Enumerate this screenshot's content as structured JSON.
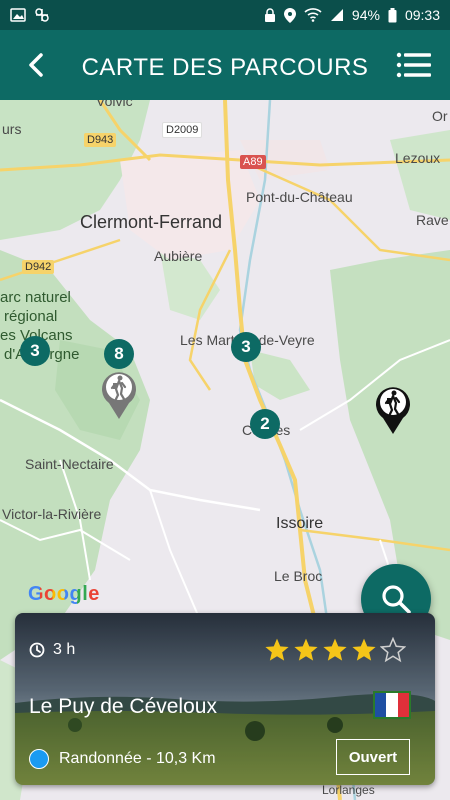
{
  "status_bar": {
    "battery": "94%",
    "time": "09:33"
  },
  "app_bar": {
    "title": "CARTE DES PARCOURS"
  },
  "map": {
    "places": [
      {
        "key": "volvic",
        "text": "Volvic"
      },
      {
        "key": "ours",
        "text": "urs"
      },
      {
        "key": "orl",
        "text": "Or"
      },
      {
        "key": "lezoux",
        "text": "Lezoux"
      },
      {
        "key": "pont",
        "text": "Pont-du-Château"
      },
      {
        "key": "clermont",
        "text": "Clermont-Ferrand"
      },
      {
        "key": "ravel",
        "text": "Rave"
      },
      {
        "key": "aubiere",
        "text": "Aubière"
      },
      {
        "key": "martres",
        "text": "Les Martres-de-Veyre"
      },
      {
        "key": "coudes",
        "text": "Coudes"
      },
      {
        "key": "nectaire",
        "text": "Saint-Nectaire"
      },
      {
        "key": "victor",
        "text": "Victor-la-Rivière"
      },
      {
        "key": "issoire",
        "text": "Issoire"
      },
      {
        "key": "broc",
        "text": "Le Broc"
      },
      {
        "key": "parc1",
        "text": "arc naturel"
      },
      {
        "key": "parc2",
        "text": "régional"
      },
      {
        "key": "parc3",
        "text": "es Volcans"
      },
      {
        "key": "parc4",
        "text": "d'Auvergne"
      },
      {
        "key": "lorlanges",
        "text": "Lorlanges"
      }
    ],
    "roads": [
      "D943",
      "D2009",
      "A89",
      "D942"
    ],
    "clusters": [
      {
        "key": "c1",
        "count": "3"
      },
      {
        "key": "c2",
        "count": "8"
      },
      {
        "key": "c3",
        "count": "3"
      },
      {
        "key": "c4",
        "count": "2"
      }
    ],
    "attribution": "Google"
  },
  "card": {
    "duration": "3 h",
    "rating": 4,
    "rating_max": 5,
    "title": "Le Puy de Céveloux",
    "type_distance": "Randonnée - 10,3 Km",
    "status_button": "Ouvert"
  },
  "colors": {
    "primary": "#0d6a64",
    "status": "#0b4f4b",
    "star": "#f5c518",
    "type_dot": "#1a9bf2"
  }
}
